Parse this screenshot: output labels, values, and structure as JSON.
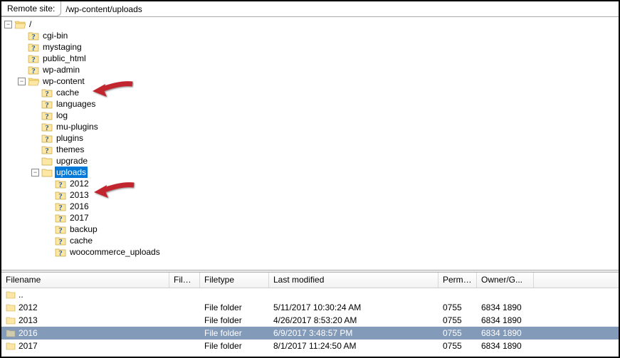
{
  "remote": {
    "label": "Remote site:",
    "path": "/wp-content/uploads"
  },
  "tree": {
    "root": "/",
    "top": [
      "cgi-bin",
      "mystaging",
      "public_html",
      "wp-admin"
    ],
    "wpcontent": {
      "name": "wp-content",
      "children": [
        "cache",
        "languages",
        "log",
        "mu-plugins",
        "plugins",
        "themes",
        "upgrade"
      ]
    },
    "uploads": {
      "name": "uploads",
      "children": [
        "2012",
        "2013",
        "2016",
        "2017",
        "backup",
        "cache",
        "woocommerce_uploads"
      ]
    }
  },
  "columns": {
    "name": "Filename",
    "size": "Filesize",
    "type": "Filetype",
    "modified": "Last modified",
    "perm": "Permissi...",
    "owner": "Owner/G..."
  },
  "files": {
    "parent": "..",
    "rows": [
      {
        "name": "2012",
        "type": "File folder",
        "modified": "5/11/2017 10:30:24 AM",
        "perm": "0755",
        "owner": "6834 1890",
        "dim": false,
        "selected": false
      },
      {
        "name": "2013",
        "type": "File folder",
        "modified": "4/26/2017 8:53:20 AM",
        "perm": "0755",
        "owner": "6834 1890",
        "dim": false,
        "selected": false
      },
      {
        "name": "2016",
        "type": "File folder",
        "modified": "6/9/2017 3:48:57 PM",
        "perm": "0755",
        "owner": "6834 1890",
        "dim": true,
        "selected": true
      },
      {
        "name": "2017",
        "type": "File folder",
        "modified": "8/1/2017 11:24:50 AM",
        "perm": "0755",
        "owner": "6834 1890",
        "dim": false,
        "selected": false
      }
    ]
  }
}
